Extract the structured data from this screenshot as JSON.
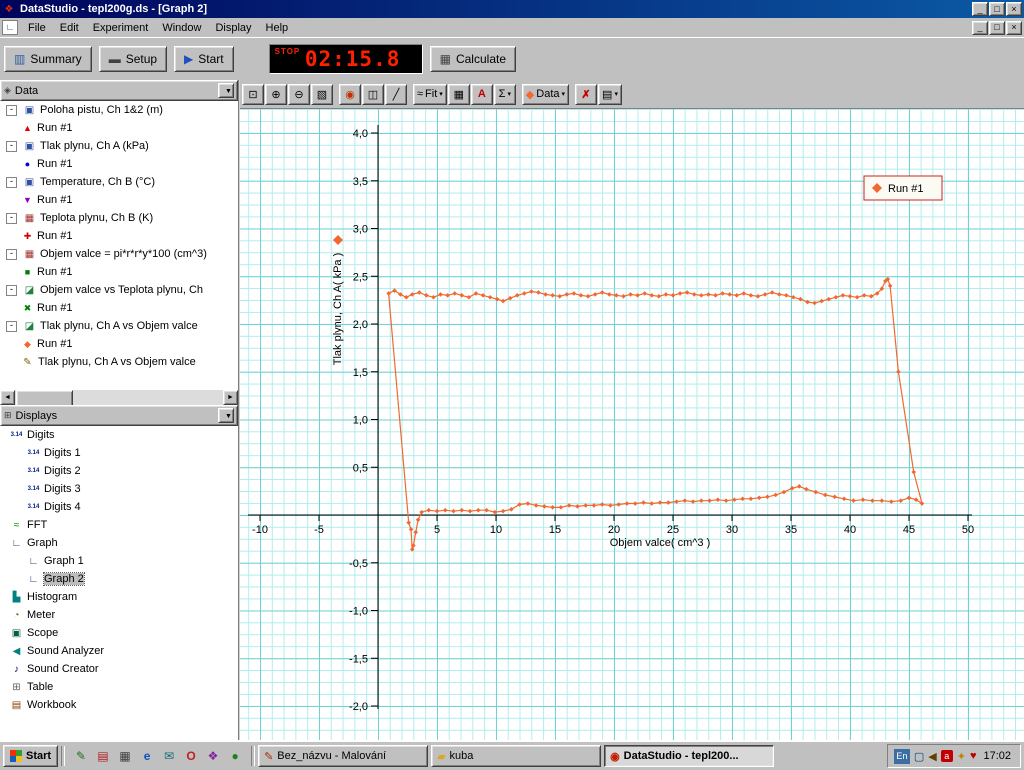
{
  "window": {
    "title": "DataStudio - tepl200g.ds - [Graph 2]"
  },
  "icons": {
    "minimize": "_",
    "maximize": "□",
    "close": "×",
    "summary": "▥",
    "setup": "▬",
    "start": "▶",
    "calculate": "▦",
    "dropdown_arrow": "▼",
    "small_arrow": "▾",
    "scroll_left": "◄",
    "scroll_right": "►",
    "data_header": "◈",
    "displays_header": "⊞",
    "child_window": "∟"
  },
  "menu": {
    "items": [
      "File",
      "Edit",
      "Experiment",
      "Window",
      "Display",
      "Help"
    ]
  },
  "toolbar": {
    "summary_label": "Summary",
    "setup_label": "Setup",
    "start_label": "Start",
    "calculate_label": "Calculate",
    "timer": {
      "status": "STOP",
      "time": "02:15.8"
    }
  },
  "graph_toolbar": {
    "buttons": [
      {
        "name": "scale-to-fit-button",
        "glyph": "⊡"
      },
      {
        "name": "zoom-in-button",
        "glyph": "⊕"
      },
      {
        "name": "zoom-out-button",
        "glyph": "⊖"
      },
      {
        "name": "zoom-select-button",
        "glyph": "▧"
      },
      {
        "name": "data-highlight-button",
        "glyph": "◉",
        "color": "#c03000",
        "gap": true
      },
      {
        "name": "show-selection-button",
        "glyph": "◫"
      },
      {
        "name": "slope-tool-button",
        "glyph": "╱"
      },
      {
        "name": "fit-menu-button",
        "glyph": "≈",
        "text": "Fit",
        "arrow": true,
        "gap": true
      },
      {
        "name": "calculator-button",
        "glyph": "▦"
      },
      {
        "name": "text-annotation-button",
        "glyph": "A",
        "color": "#c00000",
        "bold": true
      },
      {
        "name": "statistics-menu-button",
        "glyph": "Σ",
        "arrow": true
      },
      {
        "name": "data-menu-button",
        "glyph": "◆",
        "color": "#f26830",
        "text": "Data",
        "arrow": true,
        "gap": true
      },
      {
        "name": "delete-button",
        "glyph": "✗",
        "color": "#c00000",
        "bold": true,
        "gap": true
      },
      {
        "name": "graph-settings-menu-button",
        "glyph": "▤",
        "arrow": true
      }
    ]
  },
  "marker_glyphs": {
    "triangle-up": "▲",
    "circle": "●",
    "triangle-down": "▼",
    "cross": "✚",
    "square": "■",
    "x": "✖",
    "diamond": "◆"
  },
  "tree_icons": {
    "motion-sensor": {
      "glyph": "▣",
      "color": "#3050a0"
    },
    "pressure-sensor": {
      "glyph": "▣",
      "color": "#3050a0"
    },
    "temperature-sensor": {
      "glyph": "▣",
      "color": "#3050a0"
    },
    "calculation": {
      "glyph": "▦",
      "color": "#a03030"
    },
    "xy-data": {
      "glyph": "◪",
      "color": "#208040"
    },
    "pencil": {
      "glyph": "✎",
      "color": "#806000"
    },
    "digits": {
      "text": "3.14"
    },
    "fft": {
      "glyph": "≈",
      "color": "#008000"
    },
    "graph": {
      "glyph": "∟",
      "color": "#204080"
    },
    "histogram": {
      "glyph": "▙",
      "color": "#008080"
    },
    "meter": {
      "glyph": "◔",
      "color": "#806020"
    },
    "scope": {
      "glyph": "▣",
      "color": "#006040"
    },
    "sound-analyzer": {
      "glyph": "◀",
      "color": "#008080"
    },
    "sound-creator": {
      "glyph": "♪",
      "color": "#000080"
    },
    "table": {
      "glyph": "⊞",
      "color": "#606060"
    },
    "workbook": {
      "glyph": "▤",
      "color": "#804000"
    }
  },
  "sidebar": {
    "data_panel": {
      "header": "Data",
      "rows": [
        {
          "label": "Poloha pistu, Ch 1&2 (m)",
          "depth": 0,
          "expand": true,
          "icon": "motion-sensor"
        },
        {
          "label": "Run #1",
          "depth": 1,
          "marker": "triangle-up",
          "marker_color": "#e00000"
        },
        {
          "label": "Tlak plynu, Ch A (kPa)",
          "depth": 0,
          "expand": true,
          "icon": "pressure-sensor"
        },
        {
          "label": "Run #1",
          "depth": 1,
          "marker": "circle",
          "marker_color": "#0000d0"
        },
        {
          "label": "Temperature, Ch B (°C)",
          "depth": 0,
          "expand": true,
          "icon": "temperature-sensor"
        },
        {
          "label": "Run #1",
          "depth": 1,
          "marker": "triangle-down",
          "marker_color": "#9000c0"
        },
        {
          "label": "Teplota plynu, Ch B (K)",
          "depth": 0,
          "expand": true,
          "icon": "calculation"
        },
        {
          "label": "Run #1",
          "depth": 1,
          "marker": "cross",
          "marker_color": "#d00000"
        },
        {
          "label": "Objem valce = pi*r*r*y*100 (cm^3)",
          "depth": 0,
          "expand": true,
          "icon": "calculation"
        },
        {
          "label": "Run #1",
          "depth": 1,
          "marker": "square",
          "marker_color": "#008000"
        },
        {
          "label": "Objem valce vs Teplota plynu, Ch",
          "depth": 0,
          "expand": true,
          "icon": "xy-data"
        },
        {
          "label": "Run #1",
          "depth": 1,
          "marker": "x",
          "marker_color": "#008000"
        },
        {
          "label": "Tlak plynu, Ch A vs Objem valce",
          "depth": 0,
          "expand": true,
          "icon": "xy-data"
        },
        {
          "label": "Run #1",
          "depth": 1,
          "marker": "diamond",
          "marker_color": "#f26830"
        },
        {
          "label": "Tlak plynu, Ch A vs Objem valce",
          "depth": 0,
          "expand": false,
          "spacer": true,
          "icon": "pencil"
        }
      ]
    },
    "displays_panel": {
      "header": "Displays",
      "rows": [
        {
          "label": "Digits",
          "depth": 0,
          "icon": "digits"
        },
        {
          "label": "Digits 1",
          "depth": 1,
          "icon": "digits"
        },
        {
          "label": "Digits 2",
          "depth": 1,
          "icon": "digits"
        },
        {
          "label": "Digits 3",
          "depth": 1,
          "icon": "digits"
        },
        {
          "label": "Digits 4",
          "depth": 1,
          "icon": "digits"
        },
        {
          "label": "FFT",
          "depth": 0,
          "icon": "fft"
        },
        {
          "label": "Graph",
          "depth": 0,
          "icon": "graph"
        },
        {
          "label": "Graph 1",
          "depth": 1,
          "icon": "graph"
        },
        {
          "label": "Graph 2",
          "depth": 1,
          "icon": "graph",
          "selected": true
        },
        {
          "label": "Histogram",
          "depth": 0,
          "icon": "histogram"
        },
        {
          "label": "Meter",
          "depth": 0,
          "icon": "meter"
        },
        {
          "label": "Scope",
          "depth": 0,
          "icon": "scope"
        },
        {
          "label": "Sound Analyzer",
          "depth": 0,
          "icon": "sound-analyzer"
        },
        {
          "label": "Sound Creator",
          "depth": 0,
          "icon": "sound-creator"
        },
        {
          "label": "Table",
          "depth": 0,
          "icon": "table"
        },
        {
          "label": "Workbook",
          "depth": 0,
          "icon": "workbook"
        }
      ]
    }
  },
  "chart_data": {
    "type": "scatter",
    "title": "",
    "xlabel": "Objem valce( cm^3 )",
    "ylabel": "Tlak plynu, Ch A( kPa )",
    "xlim": [
      -11.5,
      55
    ],
    "ylim": [
      -2.35,
      4.25
    ],
    "grid": true,
    "x_tick_values": [
      -10,
      -5,
      5,
      10,
      15,
      20,
      25,
      30,
      35,
      40,
      45,
      50
    ],
    "x_tick_labels": [
      "-10",
      "-5",
      "5",
      "10",
      "15",
      "20",
      "25",
      "30",
      "35",
      "40",
      "45",
      "50"
    ],
    "y_tick_values": [
      4,
      3.5,
      3,
      2.5,
      2,
      1.5,
      1,
      0.5,
      -0.5,
      -1,
      -1.5,
      -2
    ],
    "y_tick_labels": [
      "4,0",
      "3,5",
      "3,0",
      "2,5",
      "2,0",
      "1,5",
      "1,0",
      "0,5",
      "-0,5",
      "-1,0",
      "-1,5",
      "-2,0"
    ],
    "legend": {
      "label": "Run #1",
      "position": "top-right"
    },
    "series": [
      {
        "name": "Run #1",
        "color": "#f26830",
        "marker": "diamond",
        "points": [
          [
            0.9,
            2.32
          ],
          [
            1.4,
            2.35
          ],
          [
            1.9,
            2.31
          ],
          [
            2.4,
            2.28
          ],
          [
            2.9,
            2.31
          ],
          [
            3.5,
            2.33
          ],
          [
            4.1,
            2.3
          ],
          [
            4.7,
            2.28
          ],
          [
            5.3,
            2.31
          ],
          [
            5.9,
            2.3
          ],
          [
            6.5,
            2.32
          ],
          [
            7.1,
            2.3
          ],
          [
            7.7,
            2.28
          ],
          [
            8.3,
            2.32
          ],
          [
            8.9,
            2.3
          ],
          [
            9.5,
            2.28
          ],
          [
            10.1,
            2.26
          ],
          [
            10.6,
            2.24
          ],
          [
            11.2,
            2.27
          ],
          [
            11.8,
            2.3
          ],
          [
            12.4,
            2.32
          ],
          [
            13.0,
            2.34
          ],
          [
            13.6,
            2.33
          ],
          [
            14.2,
            2.31
          ],
          [
            14.8,
            2.3
          ],
          [
            15.4,
            2.29
          ],
          [
            16.0,
            2.31
          ],
          [
            16.6,
            2.32
          ],
          [
            17.2,
            2.3
          ],
          [
            17.8,
            2.29
          ],
          [
            18.4,
            2.31
          ],
          [
            19.0,
            2.33
          ],
          [
            19.6,
            2.31
          ],
          [
            20.2,
            2.3
          ],
          [
            20.8,
            2.29
          ],
          [
            21.4,
            2.31
          ],
          [
            22.0,
            2.3
          ],
          [
            22.6,
            2.32
          ],
          [
            23.2,
            2.3
          ],
          [
            23.8,
            2.29
          ],
          [
            24.4,
            2.31
          ],
          [
            25.0,
            2.3
          ],
          [
            25.6,
            2.32
          ],
          [
            26.2,
            2.33
          ],
          [
            26.8,
            2.31
          ],
          [
            27.4,
            2.3
          ],
          [
            28.0,
            2.31
          ],
          [
            28.6,
            2.3
          ],
          [
            29.2,
            2.32
          ],
          [
            29.8,
            2.31
          ],
          [
            30.4,
            2.3
          ],
          [
            31.0,
            2.32
          ],
          [
            31.6,
            2.3
          ],
          [
            32.2,
            2.29
          ],
          [
            32.8,
            2.31
          ],
          [
            33.4,
            2.33
          ],
          [
            34.0,
            2.31
          ],
          [
            34.6,
            2.3
          ],
          [
            35.2,
            2.28
          ],
          [
            35.8,
            2.26
          ],
          [
            36.4,
            2.23
          ],
          [
            37.0,
            2.22
          ],
          [
            37.6,
            2.24
          ],
          [
            38.2,
            2.26
          ],
          [
            38.8,
            2.28
          ],
          [
            39.4,
            2.3
          ],
          [
            40.0,
            2.29
          ],
          [
            40.6,
            2.28
          ],
          [
            41.2,
            2.3
          ],
          [
            41.8,
            2.29
          ],
          [
            42.3,
            2.32
          ],
          [
            42.7,
            2.37
          ],
          [
            43.0,
            2.45
          ],
          [
            43.2,
            2.47
          ],
          [
            43.4,
            2.4
          ],
          [
            44.1,
            1.5
          ],
          [
            45.4,
            0.45
          ],
          [
            46.1,
            0.12
          ],
          [
            45.6,
            0.16
          ],
          [
            45.0,
            0.18
          ],
          [
            44.3,
            0.15
          ],
          [
            43.5,
            0.14
          ],
          [
            42.7,
            0.15
          ],
          [
            41.9,
            0.15
          ],
          [
            41.1,
            0.16
          ],
          [
            40.3,
            0.15
          ],
          [
            39.5,
            0.17
          ],
          [
            38.7,
            0.19
          ],
          [
            37.9,
            0.21
          ],
          [
            37.1,
            0.24
          ],
          [
            36.3,
            0.27
          ],
          [
            35.7,
            0.3
          ],
          [
            35.1,
            0.28
          ],
          [
            34.4,
            0.24
          ],
          [
            33.7,
            0.21
          ],
          [
            33.0,
            0.19
          ],
          [
            32.3,
            0.18
          ],
          [
            31.6,
            0.17
          ],
          [
            30.9,
            0.17
          ],
          [
            30.2,
            0.16
          ],
          [
            29.5,
            0.15
          ],
          [
            28.8,
            0.16
          ],
          [
            28.1,
            0.15
          ],
          [
            27.4,
            0.15
          ],
          [
            26.7,
            0.14
          ],
          [
            26.0,
            0.15
          ],
          [
            25.3,
            0.14
          ],
          [
            24.6,
            0.13
          ],
          [
            23.9,
            0.13
          ],
          [
            23.2,
            0.12
          ],
          [
            22.5,
            0.13
          ],
          [
            21.8,
            0.12
          ],
          [
            21.1,
            0.12
          ],
          [
            20.4,
            0.11
          ],
          [
            19.7,
            0.1
          ],
          [
            19.0,
            0.11
          ],
          [
            18.3,
            0.1
          ],
          [
            17.6,
            0.1
          ],
          [
            16.9,
            0.09
          ],
          [
            16.2,
            0.1
          ],
          [
            15.5,
            0.08
          ],
          [
            14.8,
            0.08
          ],
          [
            14.1,
            0.09
          ],
          [
            13.4,
            0.1
          ],
          [
            12.7,
            0.12
          ],
          [
            12.0,
            0.11
          ],
          [
            11.3,
            0.06
          ],
          [
            10.6,
            0.04
          ],
          [
            9.9,
            0.03
          ],
          [
            9.2,
            0.05
          ],
          [
            8.5,
            0.05
          ],
          [
            7.8,
            0.04
          ],
          [
            7.1,
            0.05
          ],
          [
            6.4,
            0.04
          ],
          [
            5.7,
            0.05
          ],
          [
            5.0,
            0.04
          ],
          [
            4.3,
            0.05
          ],
          [
            3.7,
            0.03
          ],
          [
            3.4,
            -0.05
          ],
          [
            3.2,
            -0.18
          ],
          [
            3.0,
            -0.32
          ],
          [
            2.9,
            -0.36
          ],
          [
            2.8,
            -0.15
          ],
          [
            2.6,
            -0.08
          ],
          [
            0.9,
            2.32
          ]
        ]
      }
    ]
  },
  "taskbar": {
    "start_label": "Start",
    "quick_launch": [
      {
        "name": "quicklaunch-notes-icon",
        "glyph": "✎",
        "color": "#207020"
      },
      {
        "name": "quicklaunch-document-icon",
        "glyph": "▤",
        "color": "#b02020"
      },
      {
        "name": "quicklaunch-printer-icon",
        "glyph": "▦",
        "color": "#404040"
      },
      {
        "name": "quicklaunch-ie-icon",
        "glyph": "e",
        "color": "#1050c0",
        "bold": true
      },
      {
        "name": "quicklaunch-mail-icon",
        "glyph": "✉",
        "color": "#107070"
      },
      {
        "name": "quicklaunch-opera-icon",
        "glyph": "O",
        "color": "#c02020",
        "bold": true
      },
      {
        "name": "quicklaunch-media-icon",
        "glyph": "❖",
        "color": "#8020a0"
      },
      {
        "name": "quicklaunch-messenger-icon",
        "glyph": "●",
        "color": "#208020"
      }
    ],
    "tasks": [
      {
        "name": "task-paint",
        "label": "Bez_názvu - Malování",
        "icon_glyph": "✎",
        "icon_color": "#a03000",
        "active": false
      },
      {
        "name": "task-folder-kuba",
        "label": "kuba",
        "icon_glyph": "▰",
        "icon_color": "#d8a820",
        "active": false
      },
      {
        "name": "task-datastudio",
        "label": "DataStudio - tepl200...",
        "icon_glyph": "◉",
        "icon_color": "#c02000",
        "active": true
      }
    ],
    "tray": {
      "language": "En",
      "icons": [
        {
          "name": "tray-display-icon",
          "glyph": "▢",
          "color": "#004080"
        },
        {
          "name": "tray-volume-icon",
          "glyph": "◀",
          "color": "#604000"
        },
        {
          "name": "tray-antivirus-icon",
          "glyph": "a",
          "badge": true
        },
        {
          "name": "tray-scheduler-icon",
          "glyph": "✦",
          "color": "#c08000"
        },
        {
          "name": "tray-monitor-icon",
          "glyph": "♥",
          "color": "#c00000"
        }
      ],
      "clock": "17:02"
    }
  }
}
